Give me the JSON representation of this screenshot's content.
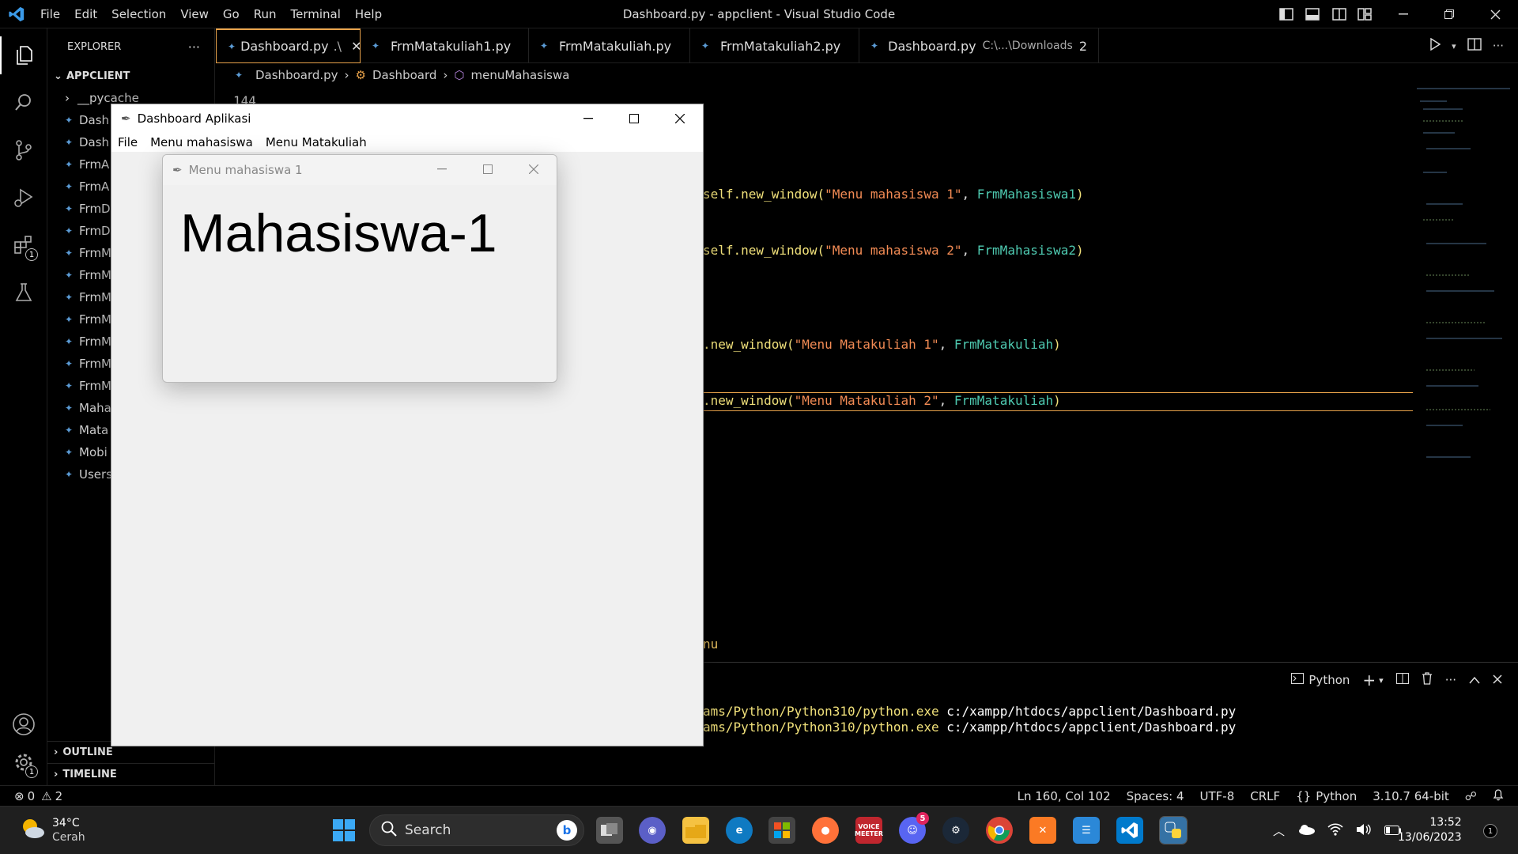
{
  "titlebar": {
    "menu": [
      "File",
      "Edit",
      "Selection",
      "View",
      "Go",
      "Run",
      "Terminal",
      "Help"
    ],
    "title": "Dashboard.py - appclient - Visual Studio Code"
  },
  "explorer": {
    "header": "EXPLORER",
    "more": "···",
    "root": "APPCLIENT",
    "folder": "__pycache__",
    "files": [
      "Dash",
      "Dash",
      "FrmA",
      "FrmA",
      "FrmD",
      "FrmD",
      "FrmM",
      "FrmM",
      "FrmM",
      "FrmM",
      "FrmM",
      "FrmM",
      "FrmM",
      "Maha",
      "Mata",
      "Mobi",
      "Users"
    ],
    "outline": "OUTLINE",
    "timeline": "TIMELINE"
  },
  "activity_badges": {
    "extensions": "1",
    "settings": "1"
  },
  "tabs": [
    {
      "label": "Dashboard.py",
      "extra": ".\\",
      "active": true
    },
    {
      "label": "FrmMatakuliah1.py",
      "extra": ""
    },
    {
      "label": "FrmMatakuliah.py",
      "extra": ""
    },
    {
      "label": "FrmMatakuliah2.py",
      "extra": ""
    },
    {
      "label": "Dashboard.py",
      "extra": "C:\\...\\Downloads",
      "count": "2"
    }
  ],
  "breadcrumb": [
    "Dashboard.py",
    "Dashboard",
    "menuMahasiswa"
  ],
  "editor": {
    "line_num": "144",
    "lines": [
      {
        "pre": "self.new_window(",
        "str": "\"Menu mahasiswa 1\"",
        "sep": ", ",
        "cls": "FrmMahasiswa1",
        "post": ")"
      },
      {
        "pre": "self.new_window(",
        "str": "\"Menu mahasiswa 2\"",
        "sep": ", ",
        "cls": "FrmMahasiswa2",
        "post": ")"
      },
      {
        "pre": ".new_window(",
        "str": "\"Menu Matakuliah 1\"",
        "sep": ", ",
        "cls": "FrmMatakuliah",
        "post": ")"
      },
      {
        "pre": ".new_window(",
        "str": "\"Menu Matakuliah 2\"",
        "sep": ", ",
        "cls": "FrmMatakuliah",
        "post": ")"
      }
    ],
    "tail": "nu"
  },
  "terminal": {
    "shell": "Python",
    "lines": [
      {
        "path": "ams/Python/Python310/python.exe",
        "arg": " c:/xampp/htdocs/appclient/Dashboard.py"
      },
      {
        "path": "ams/Python/Python310/python.exe",
        "arg": " c:/xampp/htdocs/appclient/Dashboard.py"
      }
    ]
  },
  "status": {
    "errors": "0",
    "warnings": "2",
    "position": "Ln 160, Col 102",
    "spaces": "Spaces: 4",
    "encoding": "UTF-8",
    "eol": "CRLF",
    "language": "Python",
    "interpreter": "3.10.7 64-bit"
  },
  "tk_main": {
    "title": "Dashboard Aplikasi",
    "menu": [
      "File",
      "Menu mahasiswa",
      "Menu Matakuliah"
    ]
  },
  "tk_child": {
    "title": "Menu mahasiswa 1",
    "label": "Mahasiswa-1"
  },
  "taskbar": {
    "temp": "34°C",
    "weather": "Cerah",
    "search": "Search",
    "discord_badge": "5",
    "voicemeeter": "VOICE MEETER",
    "time": "13:52",
    "date": "13/06/2023",
    "notif": "1"
  }
}
